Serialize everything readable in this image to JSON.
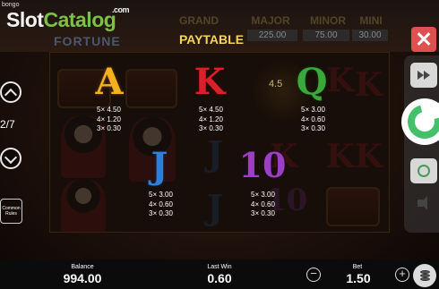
{
  "brand": {
    "small": "bongo",
    "slot": "Slot",
    "catalog": "Catalog",
    "com": ".com"
  },
  "game_title_fragment": "FORTUNE",
  "jackpots": [
    {
      "name": "GRAND",
      "value": ""
    },
    {
      "name": "MAJOR",
      "value": "225.00"
    },
    {
      "name": "MINOR",
      "value": "75.00"
    },
    {
      "name": "MINI",
      "value": "30.00"
    }
  ],
  "paytable": {
    "title": "PAYTABLE",
    "background_fragment": "4.5",
    "symbols": [
      {
        "symbol": "A",
        "color": "#f2b21e",
        "pays": [
          "5× 4.50",
          "4× 1.20",
          "3× 0.30"
        ]
      },
      {
        "symbol": "K",
        "color": "#d8202a",
        "pays": [
          "5× 4.50",
          "4× 1.20",
          "3× 0.30"
        ]
      },
      {
        "symbol": "Q",
        "color": "#3aa83a",
        "pays": [
          "5× 3.00",
          "4× 0.60",
          "3× 0.30"
        ]
      },
      {
        "symbol": "J",
        "color": "#2f7fd6",
        "pays": [
          "5× 3.00",
          "4× 0.60",
          "3× 0.30"
        ]
      },
      {
        "symbol": "10",
        "color": "#9b3fc4",
        "pays": [
          "5× 3.00",
          "4× 0.60",
          "3× 0.30"
        ]
      }
    ]
  },
  "navigation": {
    "page_indicator": "2/7",
    "common_rules": "Common Rules"
  },
  "bottom": {
    "balance_label": "Balance",
    "balance_value": "994.00",
    "last_win_label": "Last Win",
    "last_win_value": "0.60",
    "bet_label": "Bet",
    "bet_value": "1.50",
    "minus": "−",
    "plus": "+"
  },
  "colors": {
    "spin_accent": "#44c06a",
    "close_button": "#e05050",
    "paytable_title": "#f6d35a"
  }
}
